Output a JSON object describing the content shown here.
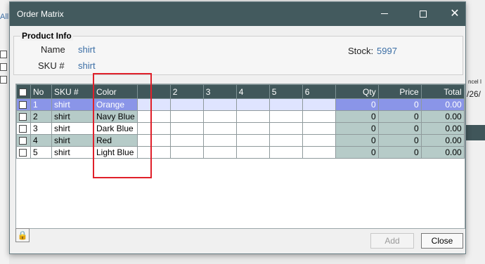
{
  "background": {
    "all_link": "All",
    "right_text_1": "ncel I",
    "right_text_2": "/26/"
  },
  "window": {
    "title": "Order Matrix"
  },
  "product_info": {
    "legend": "Product Info",
    "name_label": "Name",
    "name_value": "shirt",
    "sku_label": "SKU #",
    "sku_value": "shirt",
    "stock_label": "Stock:",
    "stock_value": "5997"
  },
  "grid": {
    "headers": [
      "No",
      "SKU #",
      "Color",
      "",
      "2",
      "3",
      "4",
      "5",
      "6",
      "Qty",
      "Price",
      "Total"
    ],
    "rows": [
      {
        "no": "1",
        "sku": "shirt",
        "color": "Orange",
        "qty": "0",
        "price": "0",
        "total": "0.00"
      },
      {
        "no": "2",
        "sku": "shirt",
        "color": "Navy Blue",
        "qty": "0",
        "price": "0",
        "total": "0.00"
      },
      {
        "no": "3",
        "sku": "shirt",
        "color": "Dark Blue",
        "qty": "0",
        "price": "0",
        "total": "0.00"
      },
      {
        "no": "4",
        "sku": "shirt",
        "color": "Red",
        "qty": "0",
        "price": "0",
        "total": "0.00"
      },
      {
        "no": "5",
        "sku": "shirt",
        "color": "Light Blue",
        "qty": "0",
        "price": "0",
        "total": "0.00"
      }
    ]
  },
  "footer": {
    "add_label": "Add",
    "close_label": "Close"
  }
}
